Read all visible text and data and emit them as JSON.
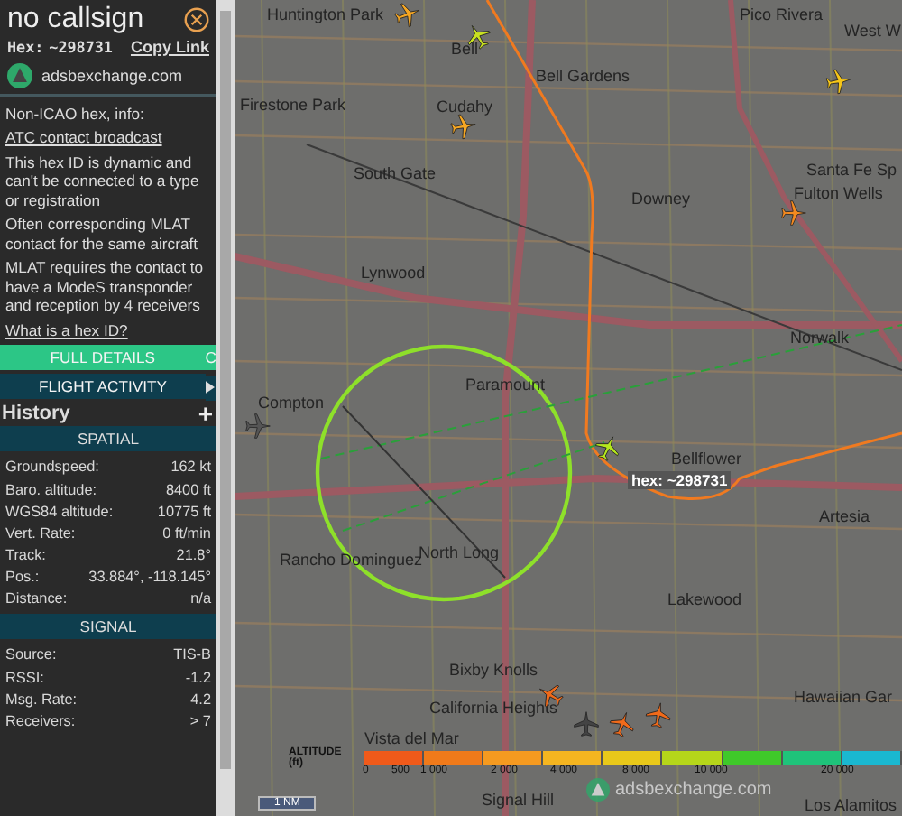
{
  "panel": {
    "title": "no callsign",
    "hex_label": "Hex:",
    "hex": "~298731",
    "copy_link": "Copy Link",
    "site": "adsbexchange.com",
    "info": [
      {
        "kind": "text",
        "text": "Non-ICAO hex, info:"
      },
      {
        "kind": "link",
        "text": "ATC contact broadcast"
      },
      {
        "kind": "text",
        "text": "This hex ID is dynamic and can't be connected to a type or registration"
      },
      {
        "kind": "text",
        "text": "Often corresponding MLAT contact for the same aircraft"
      },
      {
        "kind": "text",
        "text": "MLAT requires the contact to have a ModeS transponder and reception by 4 receivers"
      },
      {
        "kind": "link",
        "text": "What is a hex ID?"
      }
    ],
    "buttons": [
      {
        "label": "FULL DETAILS",
        "kind": "primary"
      },
      {
        "label": "C",
        "kind": "primary"
      },
      {
        "label": "FLIGHT ACTIVITY",
        "kind": "secondary"
      }
    ],
    "history": {
      "title": "History",
      "action": "+"
    },
    "sections": [
      {
        "title": "SPATIAL",
        "rows": [
          {
            "label": "Groundspeed:",
            "value": "162 kt"
          },
          {
            "label": "Baro. altitude:",
            "value": "8400 ft"
          },
          {
            "label": "WGS84 altitude:",
            "value": "10775 ft"
          },
          {
            "label": "Vert. Rate:",
            "value": "0 ft/min"
          },
          {
            "label": "Track:",
            "value": "21.8°"
          },
          {
            "label": "Pos.:",
            "value": "33.884°, -118.145°"
          },
          {
            "label": "Distance:",
            "value": "n/a"
          }
        ]
      },
      {
        "title": "SIGNAL",
        "rows": [
          {
            "label": "Source:",
            "value": "TIS-B"
          },
          {
            "label": "RSSI:",
            "value": "-1.2"
          },
          {
            "label": "Msg. Rate:",
            "value": "4.2"
          },
          {
            "label": "Receivers:",
            "value": "> 7"
          }
        ]
      }
    ]
  },
  "map": {
    "places": [
      "Huntington Park",
      "Bell",
      "Bell Gardens",
      "Pico Rivera",
      "West W",
      "Cudahy",
      "South Gate",
      "Downey",
      "Santa Fe Sp",
      "Fulton Wells",
      "Firestone Park",
      "Lynwood",
      "Norwalk",
      "Paramount",
      "Compton",
      "Bellflower",
      "Artesia",
      "Rancho Dominguez",
      "North Long",
      "Lakewood",
      "Bixby Knolls",
      "California Heights",
      "Hawaiian Gar",
      "Vista del Mar",
      "Signal Hill",
      "Los Alamitos"
    ],
    "aircraft_label": "hex: ~298731",
    "legend": {
      "title": "ALTITUDE (ft)",
      "ticks": [
        "0",
        "500",
        "1 000",
        "2 000",
        "4 000",
        "8 000",
        "10 000",
        "20 000"
      ]
    },
    "scale": "1 NM",
    "watermark": "adsbexchange.com"
  }
}
